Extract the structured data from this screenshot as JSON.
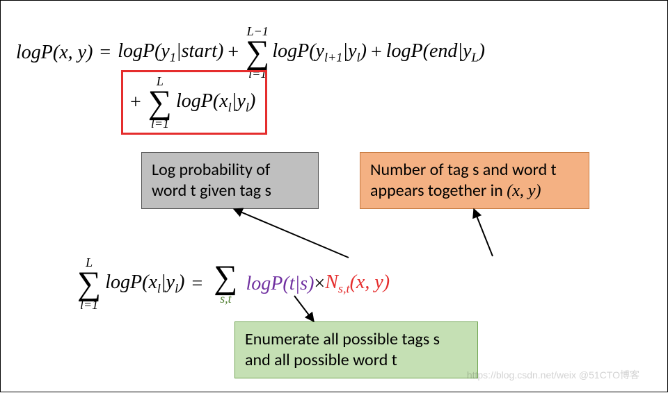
{
  "equation1": {
    "lhs": "logP(x, y)",
    "eq": "=",
    "term1_prefix": "logP(",
    "term1_y": "y",
    "term1_y_sub": "1",
    "term1_mid": "|start)",
    "plus1": "+",
    "sigma1": {
      "top": "L−1",
      "bottom": "l=1"
    },
    "term2_prefix": " logP(",
    "term2_y1": "y",
    "term2_y1_sub": "l+1",
    "term2_mid": "|",
    "term2_y2": "y",
    "term2_y2_sub": "l",
    "term2_suffix": ")",
    "plus2": "+",
    "term3_prefix": "logP(end|",
    "term3_y": "y",
    "term3_y_sub": "L",
    "term3_suffix": ")"
  },
  "boxed": {
    "plus": "+",
    "sigma": {
      "top": "L",
      "bottom": "l=1"
    },
    "logp_prefix": " logP(",
    "x": "x",
    "x_sub": "l",
    "mid": "|",
    "y": "y",
    "y_sub": "l",
    "suffix": ")"
  },
  "calloutA": "Log probability of word t given tag s",
  "calloutB_pre": "Number of tag s and word t appears together in ",
  "calloutB_math": "(x, y)",
  "equation2": {
    "sigmaL": {
      "top": "L",
      "bottom": "l=1"
    },
    "lhs_prefix": " logP(",
    "lhs_x": "x",
    "lhs_x_sub": "l",
    "lhs_mid": "|",
    "lhs_y": "y",
    "lhs_y_sub": "l",
    "lhs_suffix": ")",
    "eq": "=",
    "sigmaR": {
      "top": "",
      "bottom": "s,t"
    },
    "rhs_logp": "logP(t|s)",
    "times": " × ",
    "rhs_N": "N",
    "rhs_N_sub": "s,t",
    "rhs_paren": "(x, y)"
  },
  "calloutC": "Enumerate all possible tags s and all possible word t",
  "watermark": "https://blog.csdn.net/weix @51CTO博客"
}
